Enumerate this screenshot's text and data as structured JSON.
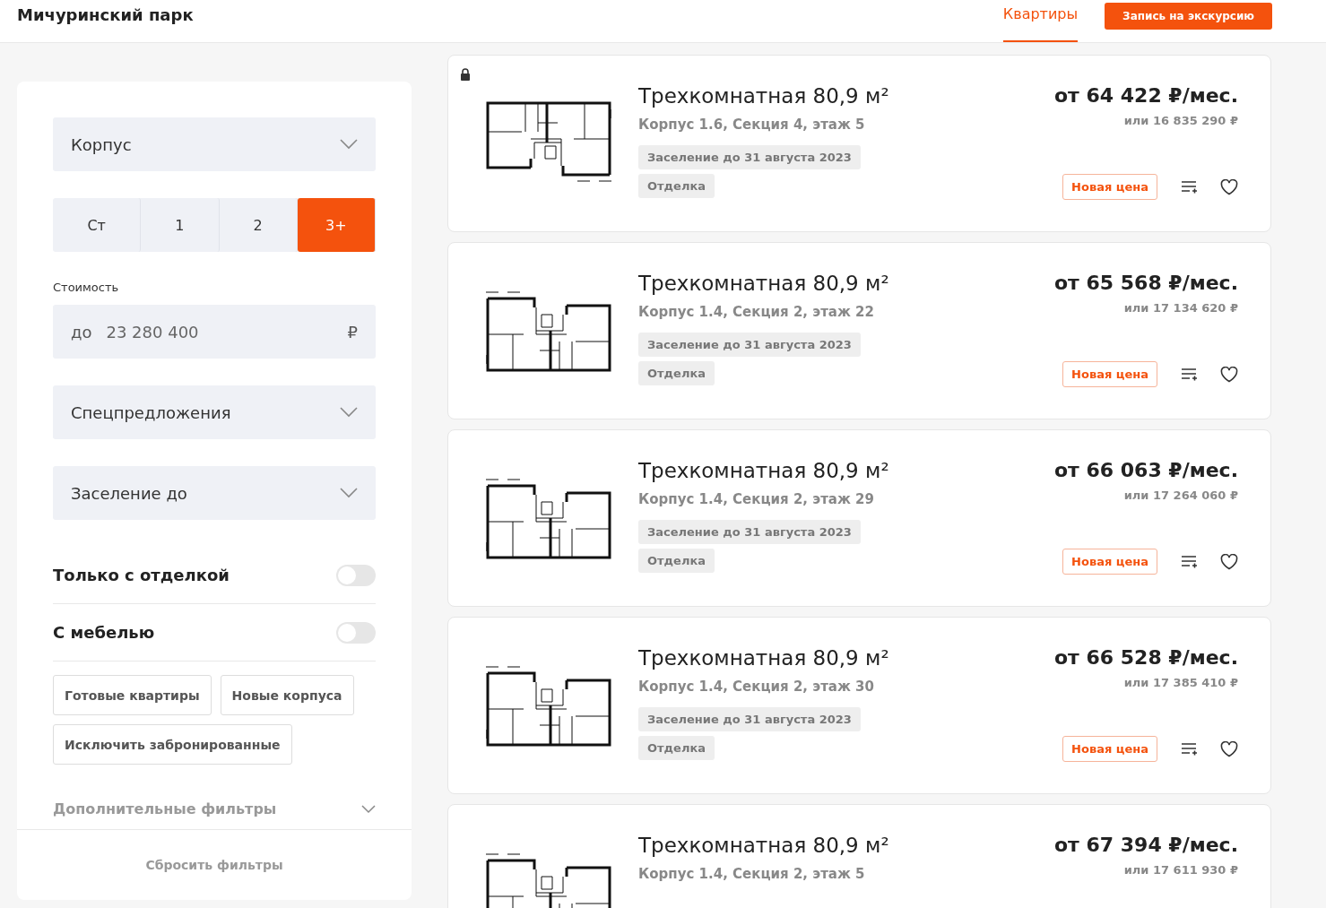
{
  "header": {
    "title": "Мичуринский парк",
    "nav": [
      {
        "label": "Квартиры",
        "selected": true
      }
    ],
    "cta": "Запись на экскурсию"
  },
  "filters": {
    "dropdowns_top": [
      {
        "label": "Корпус"
      }
    ],
    "rooms": [
      {
        "label": "Ст",
        "selected": false
      },
      {
        "label": "1",
        "selected": false
      },
      {
        "label": "2",
        "selected": false
      },
      {
        "label": "3+",
        "selected": true
      }
    ],
    "price": {
      "label": "Стоимость",
      "prefix": "до",
      "placeholder": "23 280 400",
      "currency": "₽"
    },
    "dropdowns": [
      {
        "label": "Спецпредложения"
      },
      {
        "label": "Заселение до"
      }
    ],
    "toggles": [
      {
        "label": "Только с отделкой",
        "on": false
      },
      {
        "label": "С мебелью",
        "on": false
      }
    ],
    "tags": [
      {
        "label": "Готовые квартиры",
        "selected": false
      },
      {
        "label": "Новые корпуса",
        "selected": false
      },
      {
        "label": "Исключить забронированные",
        "selected": false
      }
    ],
    "more": {
      "label": "Дополнительные фильтры",
      "expanded": false
    },
    "reset": "Сбросить фильтры"
  },
  "listings": [
    {
      "locked": true,
      "title": "Трехкомнатная 80,9 м²",
      "address": "Корпус 1.6, Секция 4, этаж 5",
      "price": "от 64 422 ₽/мес.",
      "total": "или 16 835 290 ₽",
      "tags": [
        "Заселение до 31 августа 2023",
        "Отделка"
      ],
      "badge": "Новая цена"
    },
    {
      "locked": false,
      "title": "Трехкомнатная 80,9 м²",
      "address": "Корпус 1.4, Секция 2, этаж 22",
      "price": "от 65 568 ₽/мес.",
      "total": "или 17 134 620 ₽",
      "tags": [
        "Заселение до 31 августа 2023",
        "Отделка"
      ],
      "badge": "Новая цена"
    },
    {
      "locked": false,
      "title": "Трехкомнатная 80,9 м²",
      "address": "Корпус 1.4, Секция 2, этаж 29",
      "price": "от 66 063 ₽/мес.",
      "total": "или 17 264 060 ₽",
      "tags": [
        "Заселение до 31 августа 2023",
        "Отделка"
      ],
      "badge": "Новая цена"
    },
    {
      "locked": false,
      "title": "Трехкомнатная 80,9 м²",
      "address": "Корпус 1.4, Секция 2, этаж 30",
      "price": "от 66 528 ₽/мес.",
      "total": "или 17 385 410 ₽",
      "tags": [
        "Заселение до 31 августа 2023",
        "Отделка"
      ],
      "badge": "Новая цена"
    },
    {
      "locked": false,
      "title": "Трехкомнатная 80,9 м²",
      "address": "Корпус 1.4, Секция 2, этаж 5",
      "price": "от 67 394 ₽/мес.",
      "total": "или 17 611 930 ₽"
    }
  ]
}
